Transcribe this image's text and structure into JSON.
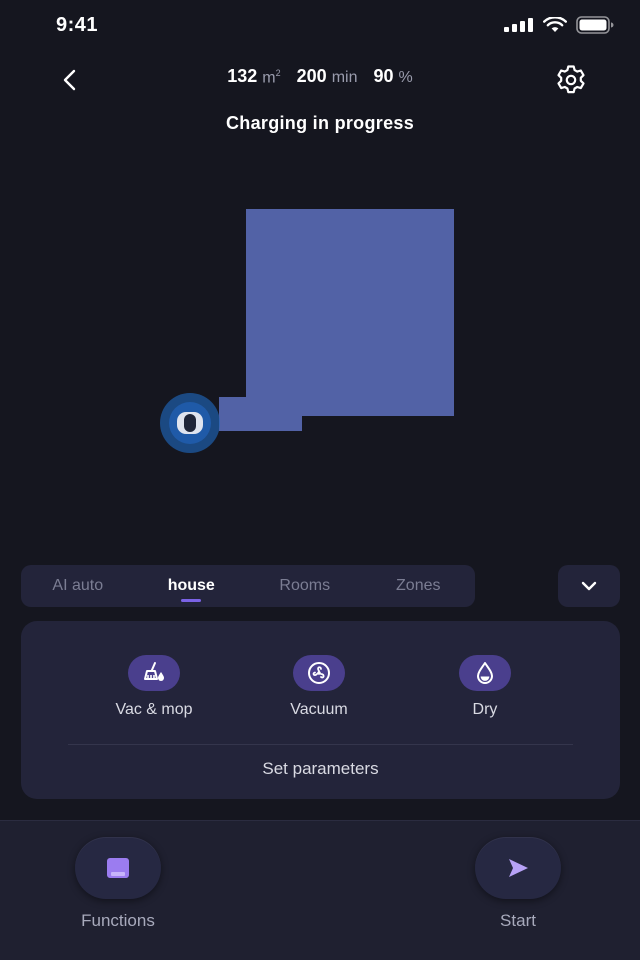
{
  "status_bar": {
    "time": "9:41"
  },
  "header": {
    "area_value": "132",
    "area_unit": "m",
    "area_exp": "2",
    "time_value": "200",
    "time_unit": "min",
    "battery_value": "90",
    "battery_unit": "%"
  },
  "status_text": "Charging in progress",
  "tabs": [
    {
      "label": "AI auto",
      "active": false
    },
    {
      "label": "house",
      "active": true
    },
    {
      "label": "Rooms",
      "active": false
    },
    {
      "label": "Zones",
      "active": false
    }
  ],
  "clean_modes": [
    {
      "label": "Vac & mop",
      "icon": "broom-mop-icon"
    },
    {
      "label": "Vacuum",
      "icon": "fan-icon"
    },
    {
      "label": "Dry",
      "icon": "water-drop-icon"
    }
  ],
  "set_parameters_label": "Set parameters",
  "actions": {
    "functions_label": "Functions",
    "start_label": "Start"
  },
  "colors": {
    "background": "#15161f",
    "panel": "#23243a",
    "map_area": "#5262a6",
    "accent": "#7b63e6",
    "mode_icon_bg": "#4a3f8d",
    "robot_halo": "#1e66b8"
  }
}
